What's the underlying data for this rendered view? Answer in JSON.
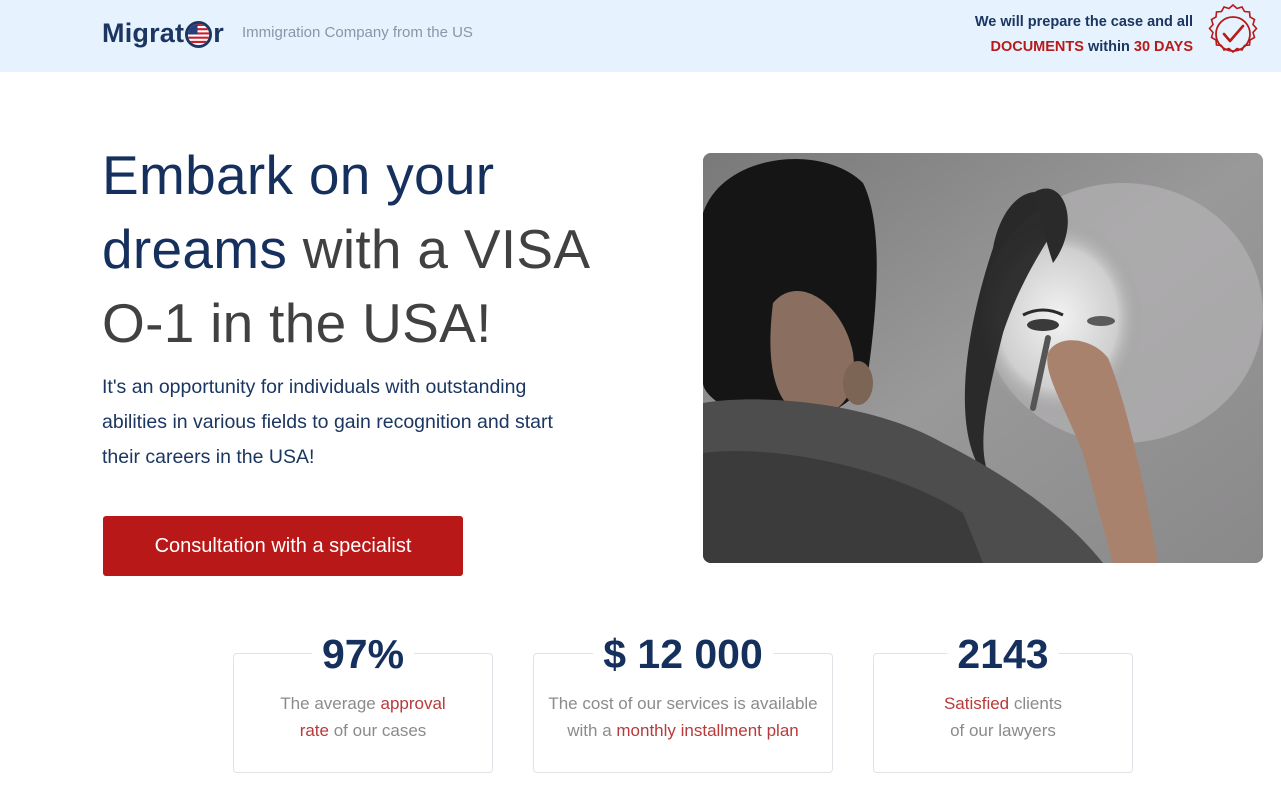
{
  "header": {
    "logo": {
      "part1": "Migrat",
      "part2": "r"
    },
    "tagline": "Immigration Company from the US",
    "promise": {
      "line1": "We will prepare the case and all",
      "documents": "DOCUMENTS",
      "within": "within",
      "days": "30 DAYS"
    }
  },
  "hero": {
    "headline": {
      "blue1": "Embark on your",
      "blue2": "dreams",
      "grey1": "with a VISA",
      "grey2": "O-1 in the USA!"
    },
    "lead": "It's an opportunity for individuals with outstanding abilities in various fields to gain recognition and start their careers in the USA!",
    "cta_label": "Consultation with a specialist"
  },
  "stats": [
    {
      "value": "97%",
      "pre": "The average ",
      "red": "approval",
      "red2": "rate",
      "post": " of our cases"
    },
    {
      "value": "$ 12 000",
      "line1": "The cost of our services is available",
      "pre": "with a ",
      "red": "monthly installment plan"
    },
    {
      "value": "2143",
      "red": "Satisfied",
      "post": " clients",
      "line2": "of our lawyers"
    }
  ],
  "colors": {
    "brand_blue": "#16305e",
    "accent_red": "#b81818",
    "header_bg": "#e6f2fd"
  }
}
